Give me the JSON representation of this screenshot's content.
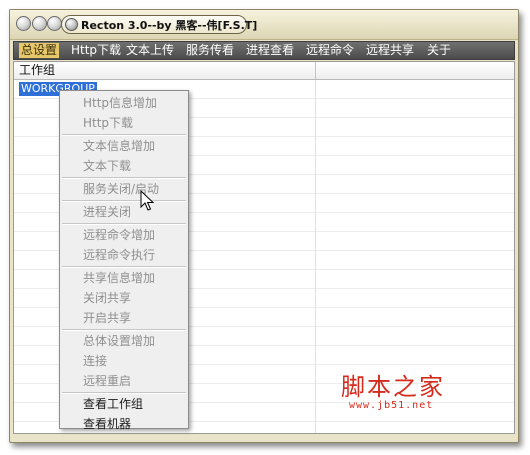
{
  "window": {
    "title": "Recton 3.0--by 黑客--伟[F.S.T]"
  },
  "menu": {
    "items": [
      {
        "label": "总设置",
        "active": true
      },
      {
        "label": "Http下载"
      },
      {
        "label": "文本上传"
      },
      {
        "label": "服务传看"
      },
      {
        "label": "进程查看"
      },
      {
        "label": "远程命令"
      },
      {
        "label": "远程共享"
      },
      {
        "label": "关于"
      }
    ]
  },
  "table": {
    "columns": [
      "工作组",
      ""
    ],
    "rows": [
      "WORKGROUP"
    ]
  },
  "context_menu": {
    "groups": [
      [
        {
          "label": "Http信息增加",
          "enabled": false
        },
        {
          "label": "Http下载",
          "enabled": false
        }
      ],
      [
        {
          "label": "文本信息增加",
          "enabled": false
        },
        {
          "label": "文本下载",
          "enabled": false
        }
      ],
      [
        {
          "label": "服务关闭/启动",
          "enabled": false
        }
      ],
      [
        {
          "label": "进程关闭",
          "enabled": false
        }
      ],
      [
        {
          "label": "远程命令增加",
          "enabled": false
        },
        {
          "label": "远程命令执行",
          "enabled": false
        }
      ],
      [
        {
          "label": "共享信息增加",
          "enabled": false
        },
        {
          "label": "关闭共享",
          "enabled": false
        },
        {
          "label": "开启共享",
          "enabled": false
        }
      ],
      [
        {
          "label": "总体设置增加",
          "enabled": false
        },
        {
          "label": "连接",
          "enabled": false
        },
        {
          "label": "远程重启",
          "enabled": false
        }
      ],
      [
        {
          "label": "查看工作组",
          "enabled": true
        },
        {
          "label": "查看机器",
          "enabled": true
        }
      ]
    ]
  },
  "watermark": {
    "main": "脚本之家",
    "sub": "www.jb51.net"
  }
}
